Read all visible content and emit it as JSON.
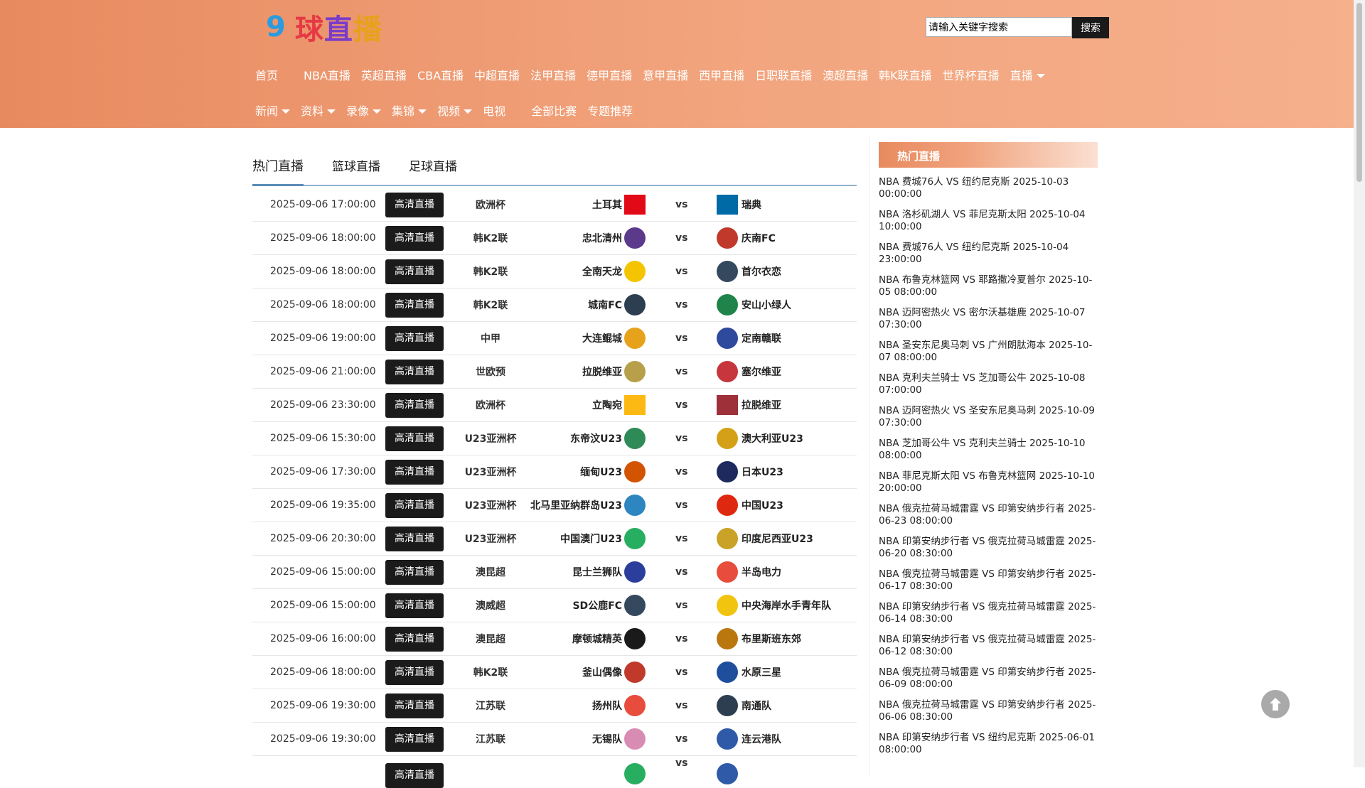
{
  "logo": {
    "mark": "9",
    "chars": [
      "球",
      "直",
      "播"
    ],
    "colors": [
      "#e63946",
      "#7a3cc8",
      "#e6a21a"
    ]
  },
  "search": {
    "placeholder": "请输入关键字搜索",
    "button": "搜索"
  },
  "nav_primary": [
    {
      "label": "首页",
      "caret": false
    },
    {
      "label": "NBA直播",
      "caret": false
    },
    {
      "label": "英超直播",
      "caret": false
    },
    {
      "label": "CBA直播",
      "caret": false
    },
    {
      "label": "中超直播",
      "caret": false
    },
    {
      "label": "法甲直播",
      "caret": false
    },
    {
      "label": "德甲直播",
      "caret": false
    },
    {
      "label": "意甲直播",
      "caret": false
    },
    {
      "label": "西甲直播",
      "caret": false
    },
    {
      "label": "日职联直播",
      "caret": false
    },
    {
      "label": "澳超直播",
      "caret": false
    },
    {
      "label": "韩K联直播",
      "caret": false
    },
    {
      "label": "世界杯直播",
      "caret": false
    },
    {
      "label": "直播",
      "caret": true
    }
  ],
  "nav_secondary": [
    {
      "label": "新闻",
      "caret": true
    },
    {
      "label": "资料",
      "caret": true
    },
    {
      "label": "录像",
      "caret": true
    },
    {
      "label": "集锦",
      "caret": true
    },
    {
      "label": "视频",
      "caret": true
    },
    {
      "label": "电视",
      "caret": false
    },
    {
      "label": "全部比赛",
      "caret": false
    },
    {
      "label": "专题推荐",
      "caret": false
    }
  ],
  "tabs": [
    "热门直播",
    "篮球直播",
    "足球直播"
  ],
  "live_button": "高清直播",
  "vs_label": "vs",
  "matches": [
    {
      "time": "2025-09-06 17:00:00",
      "league": "欧洲杯",
      "home": "土耳其",
      "away": "瑞典",
      "home_color": "#e30a17",
      "away_color": "#006aa7",
      "home_flag": true,
      "away_flag": true
    },
    {
      "time": "2025-09-06 18:00:00",
      "league": "韩K2联",
      "home": "忠北清州",
      "away": "庆南FC",
      "home_color": "#5b3a8c",
      "away_color": "#c0392b"
    },
    {
      "time": "2025-09-06 18:00:00",
      "league": "韩K2联",
      "home": "全南天龙",
      "away": "首尔衣恋",
      "home_color": "#f5c400",
      "away_color": "#34495e"
    },
    {
      "time": "2025-09-06 18:00:00",
      "league": "韩K2联",
      "home": "城南FC",
      "away": "安山小绿人",
      "home_color": "#2c3e50",
      "away_color": "#1e8449"
    },
    {
      "time": "2025-09-06 19:00:00",
      "league": "中甲",
      "home": "大连鲲城",
      "away": "定南赣联",
      "home_color": "#e6a21a",
      "away_color": "#2e4a9c"
    },
    {
      "time": "2025-09-06 21:00:00",
      "league": "世欧预",
      "home": "拉脱维亚",
      "away": "塞尔维亚",
      "home_color": "#b8a04a",
      "away_color": "#c6363c"
    },
    {
      "time": "2025-09-06 23:30:00",
      "league": "欧洲杯",
      "home": "立陶宛",
      "away": "拉脱维亚",
      "home_color": "#fdb913",
      "away_color": "#9e3039",
      "home_flag": true,
      "away_flag": true
    },
    {
      "time": "2025-09-06 15:30:00",
      "league": "U23亚洲杯",
      "home": "东帝汶U23",
      "away": "澳大利亚U23",
      "home_color": "#2e8b57",
      "away_color": "#d4a017"
    },
    {
      "time": "2025-09-06 17:30:00",
      "league": "U23亚洲杯",
      "home": "缅甸U23",
      "away": "日本U23",
      "home_color": "#d35400",
      "away_color": "#1c2a5e"
    },
    {
      "time": "2025-09-06 19:35:00",
      "league": "U23亚洲杯",
      "home": "北马里亚纳群岛U23",
      "away": "中国U23",
      "home_color": "#2e86c1",
      "away_color": "#de2910"
    },
    {
      "time": "2025-09-06 20:30:00",
      "league": "U23亚洲杯",
      "home": "中国澳门U23",
      "away": "印度尼西亚U23",
      "home_color": "#27ae60",
      "away_color": "#c9a227"
    },
    {
      "time": "2025-09-06 15:00:00",
      "league": "澳昆超",
      "home": "昆士兰狮队",
      "away": "半岛电力",
      "home_color": "#2c3e9c",
      "away_color": "#e74c3c"
    },
    {
      "time": "2025-09-06 15:00:00",
      "league": "澳威超",
      "home": "SD公鹿FC",
      "away": "中央海岸水手青年队",
      "home_color": "#34495e",
      "away_color": "#f1c40f"
    },
    {
      "time": "2025-09-06 16:00:00",
      "league": "澳昆超",
      "home": "摩顿城精英",
      "away": "布里斯班东郊",
      "home_color": "#1a1a1a",
      "away_color": "#b9770e"
    },
    {
      "time": "2025-09-06 18:00:00",
      "league": "韩K2联",
      "home": "釜山偶像",
      "away": "水原三星",
      "home_color": "#c0392b",
      "away_color": "#1f4e9c"
    },
    {
      "time": "2025-09-06 19:30:00",
      "league": "江苏联",
      "home": "扬州队",
      "away": "南通队",
      "home_color": "#e74c3c",
      "away_color": "#2c3e50"
    },
    {
      "time": "2025-09-06 19:30:00",
      "league": "江苏联",
      "home": "无锡队",
      "away": "连云港队",
      "home_color": "#d98cb3",
      "away_color": "#2e5aa8"
    },
    {
      "time": "",
      "league": "",
      "home": "",
      "away": "",
      "home_color": "#27ae60",
      "away_color": "#2e5aa8"
    }
  ],
  "sidebar": {
    "title": "热门直播",
    "items": [
      "NBA 费城76人 VS 纽约尼克斯 2025-10-03 00:00:00",
      "NBA 洛杉矶湖人 VS 菲尼克斯太阳 2025-10-04 10:00:00",
      "NBA 费城76人 VS 纽约尼克斯 2025-10-04 23:00:00",
      "NBA 布鲁克林篮网 VS 耶路撒冷夏普尔 2025-10-05 08:00:00",
      "NBA 迈阿密热火 VS 密尔沃基雄鹿 2025-10-07 07:30:00",
      "NBA 圣安东尼奥马刺 VS 广州朗肽海本 2025-10-07 08:00:00",
      "NBA 克利夫兰骑士 VS 芝加哥公牛 2025-10-08 07:00:00",
      "NBA 迈阿密热火 VS 圣安东尼奥马刺 2025-10-09 07:30:00",
      "NBA 芝加哥公牛 VS 克利夫兰骑士 2025-10-10 08:00:00",
      "NBA 菲尼克斯太阳 VS 布鲁克林篮网 2025-10-10 20:00:00",
      "NBA 俄克拉荷马城雷霆 VS 印第安纳步行者 2025-06-23 08:00:00",
      "NBA 印第安纳步行者 VS 俄克拉荷马城雷霆 2025-06-20 08:30:00",
      "NBA 俄克拉荷马城雷霆 VS 印第安纳步行者 2025-06-17 08:30:00",
      "NBA 印第安纳步行者 VS 俄克拉荷马城雷霆 2025-06-14 08:30:00",
      "NBA 印第安纳步行者 VS 俄克拉荷马城雷霆 2025-06-12 08:30:00",
      "NBA 俄克拉荷马城雷霆 VS 印第安纳步行者 2025-06-09 08:00:00",
      "NBA 俄克拉荷马城雷霆 VS 印第安纳步行者 2025-06-06 08:30:00",
      "NBA 印第安纳步行者 VS 纽约尼克斯 2025-06-01 08:00:00"
    ]
  }
}
